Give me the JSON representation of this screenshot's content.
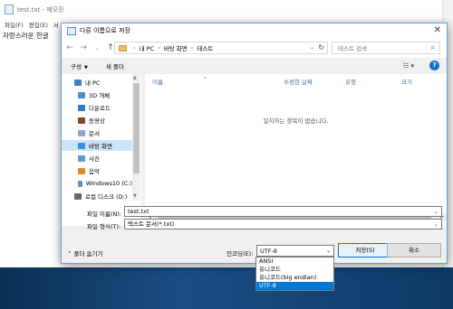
{
  "notepad": {
    "title": "test.txt - 메모장",
    "menu": [
      "파일(F)",
      "편집(E)",
      "서"
    ],
    "text": "자랑스러운 한글"
  },
  "dialog": {
    "title": "다른 이름으로 저장",
    "close_glyph": "✕",
    "address": [
      "내 PC",
      "바탕 화면",
      "테스트"
    ],
    "search_placeholder": "테스트 검색",
    "toolbar": {
      "organize": "구성",
      "new_folder": "새 폴더"
    },
    "nav_items": [
      {
        "label": "내 PC",
        "color": "#3a7fc8"
      },
      {
        "label": "3D 개체",
        "color": "#4a8fd4"
      },
      {
        "label": "다운로드",
        "color": "#2f7bd0"
      },
      {
        "label": "동영상",
        "color": "#7a4a2a"
      },
      {
        "label": "문서",
        "color": "#8aa9cf"
      },
      {
        "label": "바탕 화면",
        "color": "#3a8fe0",
        "selected": true
      },
      {
        "label": "사진",
        "color": "#5b9bd5"
      },
      {
        "label": "음악",
        "color": "#e28b2c"
      },
      {
        "label": "Windows10 (C:)",
        "color": "#6a8fb5"
      },
      {
        "label": "로컬 디스크 (D:)",
        "color": "#666666"
      }
    ],
    "columns": {
      "name": "이름",
      "date": "수정한 날짜",
      "type": "유형",
      "size": "크기"
    },
    "empty_message": "일치하는 항목이 없습니다.",
    "filename_label": "파일 이름(N):",
    "filename_value": "test.txt",
    "filetype_label": "파일 형식(T):",
    "filetype_value": "텍스트 문서(*.txt)",
    "hide_folders": "폴더 숨기기",
    "encoding_label": "인코딩(E):",
    "encoding_value": "UTF-8",
    "save": "저장(S)",
    "cancel": "취소",
    "encoding_options": [
      "ANSI",
      "유니코드",
      "유니코드(big endian)",
      "UTF-8"
    ]
  }
}
